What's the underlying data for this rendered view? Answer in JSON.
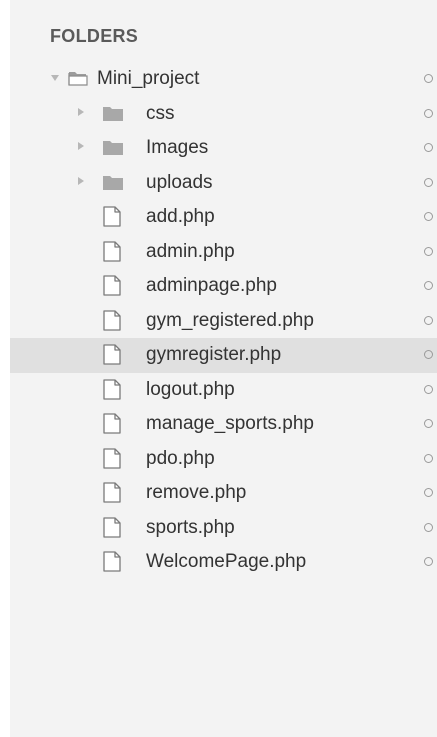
{
  "sidebar": {
    "header": "FOLDERS",
    "root": {
      "name": "Mini_project",
      "expanded": true,
      "icon": "folder-open-icon"
    },
    "folders": [
      {
        "name": "css",
        "expanded": false,
        "icon": "folder-icon"
      },
      {
        "name": "Images",
        "expanded": false,
        "icon": "folder-icon"
      },
      {
        "name": "uploads",
        "expanded": false,
        "icon": "folder-icon"
      }
    ],
    "files": [
      {
        "name": "add.php",
        "icon": "file-icon"
      },
      {
        "name": "admin.php",
        "icon": "file-icon"
      },
      {
        "name": "adminpage.php",
        "icon": "file-icon"
      },
      {
        "name": "gym_registered.php",
        "icon": "file-icon"
      },
      {
        "name": "gymregister.php",
        "icon": "file-icon",
        "selected": true
      },
      {
        "name": "logout.php",
        "icon": "file-icon"
      },
      {
        "name": "manage_sports.php",
        "icon": "file-icon"
      },
      {
        "name": "pdo.php",
        "icon": "file-icon"
      },
      {
        "name": "remove.php",
        "icon": "file-icon"
      },
      {
        "name": "sports.php",
        "icon": "file-icon"
      },
      {
        "name": "WelcomePage.php",
        "icon": "file-icon"
      }
    ],
    "colors": {
      "background": "#f3f3f3",
      "selected_row": "#e0e0e0",
      "text": "#333333",
      "header_text": "#5a5a5a",
      "folder_fill": "#a8a8a8",
      "icon_stroke": "#7a7a7a"
    }
  }
}
